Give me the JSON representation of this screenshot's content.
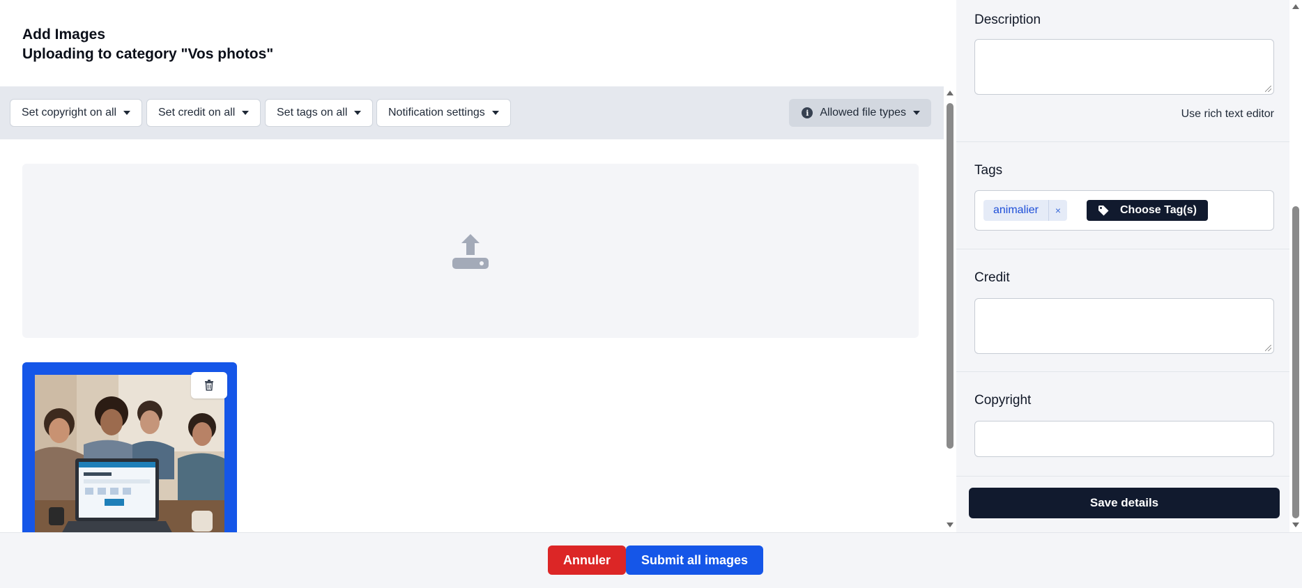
{
  "header": {
    "title": "Add Images",
    "subtitle": "Uploading to category \"Vos photos\""
  },
  "toolbar": {
    "copyright_label": "Set copyright on all",
    "credit_label": "Set credit on all",
    "tags_label": "Set tags on all",
    "notification_label": "Notification settings",
    "allowed_label": "Allowed file types"
  },
  "icons": {
    "upload": "upload-icon",
    "trash": "trash-icon",
    "info": "info-icon",
    "tag": "tag-icon",
    "caret": "caret-down-icon"
  },
  "side": {
    "description_label": "Description",
    "description_value": "",
    "rich_text_label": "Use rich text editor",
    "tags_label": "Tags",
    "tags": [
      "animalier"
    ],
    "tag_remove": "×",
    "choose_tags_label": "Choose Tag(s)",
    "credit_label": "Credit",
    "credit_value": "",
    "copyright_label": "Copyright",
    "copyright_value": "",
    "save_label": "Save details"
  },
  "footer": {
    "cancel_label": "Annuler",
    "submit_label": "Submit all images"
  },
  "colors": {
    "primary": "#1556e8",
    "danger": "#dc2626",
    "dark": "#111a2e",
    "toolbar_bg": "#e5e8ee",
    "panel_bg": "#f4f5f8"
  }
}
